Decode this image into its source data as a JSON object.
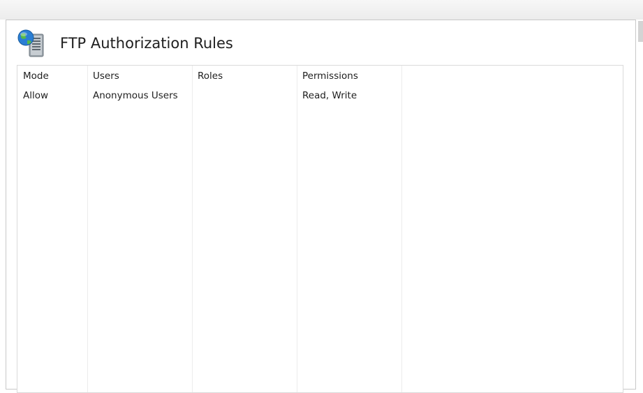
{
  "page": {
    "title": "FTP Authorization Rules"
  },
  "icons": {
    "feature": "ftp-authorization-globe-server-icon"
  },
  "table": {
    "columns": [
      "Mode",
      "Users",
      "Roles",
      "Permissions"
    ],
    "rows": [
      {
        "mode": "Allow",
        "users": "Anonymous Users",
        "roles": "",
        "permissions": "Read, Write"
      }
    ]
  },
  "colors": {
    "grid_border": "#dadada",
    "column_divider": "#ececec",
    "text": "#1e1e1e"
  }
}
